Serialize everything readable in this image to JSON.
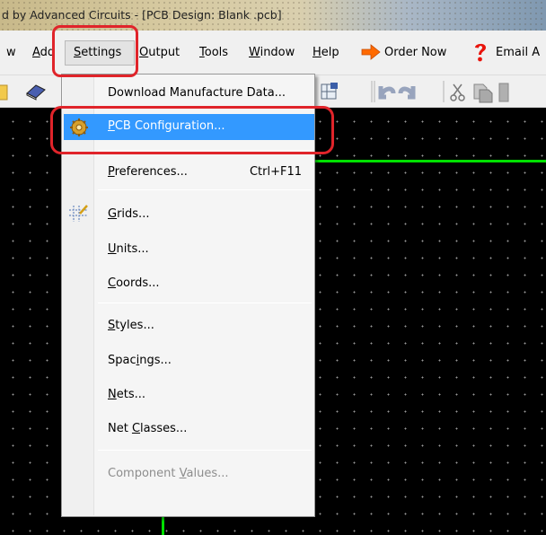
{
  "window": {
    "title": "d by Advanced Circuits - [PCB Design: Blank .pcb]"
  },
  "menubar": {
    "items": [
      {
        "pre": "w",
        "ul": "",
        "post": ""
      },
      {
        "pre": "",
        "ul": "A",
        "post": "dd"
      },
      {
        "pre": "",
        "ul": "S",
        "post": "ettings"
      },
      {
        "pre": "",
        "ul": "O",
        "post": "utput"
      },
      {
        "pre": "",
        "ul": "T",
        "post": "ools"
      },
      {
        "pre": "",
        "ul": "W",
        "post": "indow"
      },
      {
        "pre": "",
        "ul": "H",
        "post": "elp"
      },
      {
        "pre": "Order Now",
        "ul": "",
        "post": ""
      },
      {
        "pre": "Email A",
        "ul": "",
        "post": ""
      }
    ]
  },
  "icons": {
    "order": "arrow-right-icon",
    "help": "question-mark-icon",
    "pcb_config": "gear-icon",
    "grids": "grid-icon",
    "toolbar": [
      "open-folder-icon",
      "book-icon",
      "grid-properties-icon",
      "undo-icon",
      "redo-icon",
      "cut-icon",
      "copy-icon",
      "paste-icon"
    ]
  },
  "colors": {
    "highlight": "#3399ff",
    "annotation": "#e0242a",
    "canvas": "#000000",
    "trace": "#00e000"
  },
  "dropdown": {
    "items": [
      {
        "pre": "Download Manufacture Data...",
        "ul": "",
        "post": "",
        "shortcut": "",
        "state": "normal"
      },
      {
        "pre": "",
        "ul": "P",
        "post": "CB Configuration...",
        "shortcut": "",
        "state": "highlighted"
      },
      {
        "pre": "",
        "ul": "P",
        "post": "references...",
        "shortcut": "Ctrl+F11",
        "state": "normal"
      },
      {
        "pre": "",
        "ul": "G",
        "post": "rids...",
        "shortcut": "",
        "state": "normal"
      },
      {
        "pre": "",
        "ul": "U",
        "post": "nits...",
        "shortcut": "",
        "state": "normal"
      },
      {
        "pre": "",
        "ul": "C",
        "post": "oords...",
        "shortcut": "",
        "state": "normal"
      },
      {
        "pre": "",
        "ul": "S",
        "post": "tyles...",
        "shortcut": "",
        "state": "normal"
      },
      {
        "pre": "Spac",
        "ul": "i",
        "post": "ngs...",
        "shortcut": "",
        "state": "normal"
      },
      {
        "pre": "",
        "ul": "N",
        "post": "ets...",
        "shortcut": "",
        "state": "normal"
      },
      {
        "pre": "Net ",
        "ul": "C",
        "post": "lasses...",
        "shortcut": "",
        "state": "normal"
      },
      {
        "pre": "Component ",
        "ul": "V",
        "post": "alues...",
        "shortcut": "",
        "state": "disabled"
      }
    ]
  }
}
